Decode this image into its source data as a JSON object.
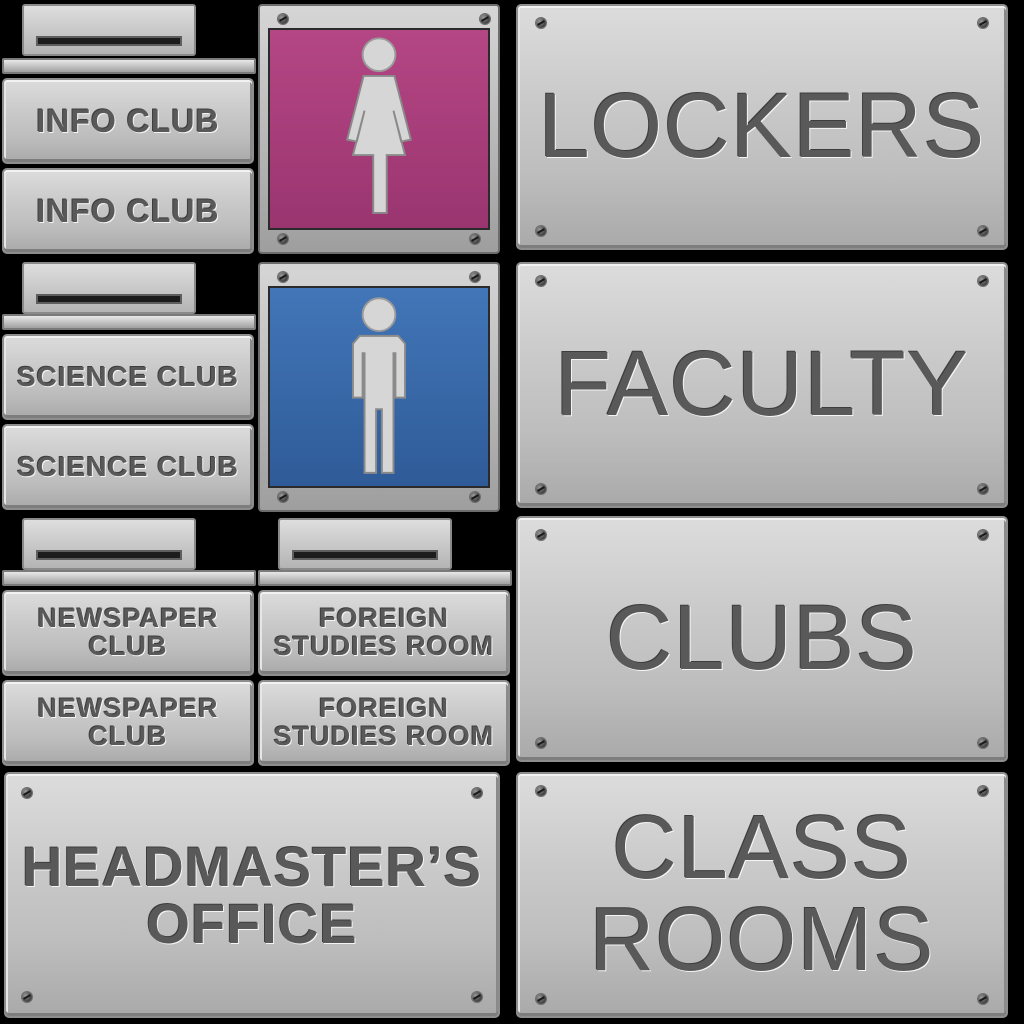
{
  "colors": {
    "women_sign": "#a83c78",
    "men_sign": "#3a68a8",
    "figure": "#d4d4d4",
    "engraved_text": "#595959"
  },
  "icons": {
    "women": "woman-restroom-icon",
    "men": "man-restroom-icon"
  },
  "small_plates": {
    "info_top": "INFO CLUB",
    "info_bottom": "INFO CLUB",
    "science_top": "SCIENCE CLUB",
    "science_bottom": "SCIENCE CLUB",
    "newspaper_top": "NEWSPAPER\nCLUB",
    "newspaper_bottom": "NEWSPAPER\nCLUB",
    "foreign_top": "FOREIGN\nSTUDIES ROOM",
    "foreign_bottom": "FOREIGN\nSTUDIES ROOM"
  },
  "large_plates": {
    "lockers": "LOCKERS",
    "faculty": "FACULTY",
    "clubs": "CLUBS",
    "classrooms": "CLASS\nROOMS",
    "headmaster": "HEADMASTER’S\nOFFICE"
  }
}
